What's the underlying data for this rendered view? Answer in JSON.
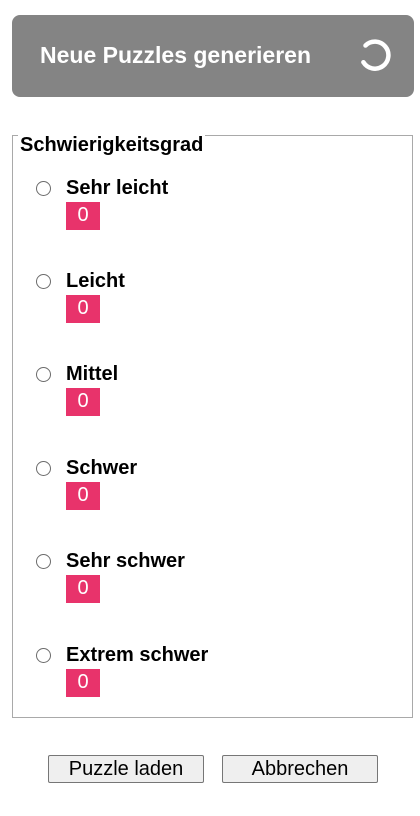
{
  "generate": {
    "label": "Neue Puzzles generieren",
    "icon": "loading-spinner-icon",
    "background": "#848484"
  },
  "difficulty": {
    "legend": "Schwierigkeitsgrad",
    "badge_color": "#e8336b",
    "options": [
      {
        "label": "Sehr leicht",
        "count": "0",
        "selected": false
      },
      {
        "label": "Leicht",
        "count": "0",
        "selected": false
      },
      {
        "label": "Mittel",
        "count": "0",
        "selected": false
      },
      {
        "label": "Schwer",
        "count": "0",
        "selected": false
      },
      {
        "label": "Sehr schwer",
        "count": "0",
        "selected": false
      },
      {
        "label": "Extrem schwer",
        "count": "0",
        "selected": false
      }
    ]
  },
  "actions": {
    "load_label": "Puzzle laden",
    "cancel_label": "Abbrechen"
  }
}
